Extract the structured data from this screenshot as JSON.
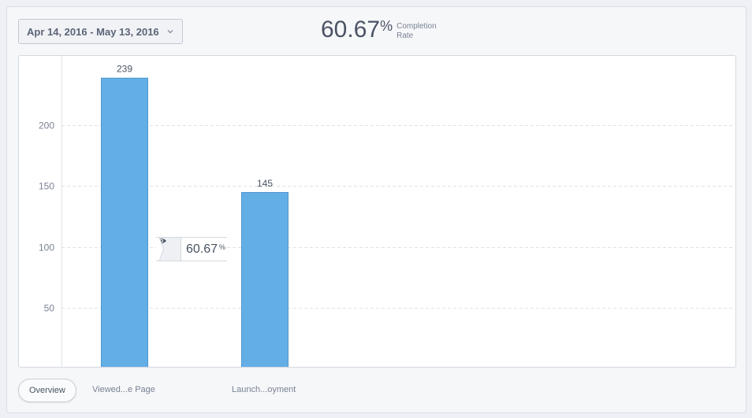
{
  "header": {
    "date_range": "Apr 14, 2016 - May 13, 2016",
    "completion_value": "60.67",
    "completion_suffix": "%",
    "completion_label_line1": "Completion",
    "completion_label_line2": "Rate"
  },
  "tooltip": {
    "value": "60.67",
    "suffix": "%",
    "icon": "eye-icon"
  },
  "tabs": {
    "overview": "Overview",
    "step1": "Viewed...e Page",
    "step2": "Launch...oyment"
  },
  "colors": {
    "bar": "#64aee6",
    "bar_border": "#4f97d0"
  },
  "chart_data": {
    "type": "bar",
    "categories": [
      "Viewed...e Page",
      "Launch...oyment"
    ],
    "values": [
      239,
      145
    ],
    "data_labels": [
      "239",
      "145"
    ],
    "yticks": [
      50,
      100,
      150,
      200
    ],
    "ylim": [
      0,
      250
    ],
    "grid": true,
    "title": "",
    "xlabel": "",
    "ylabel": ""
  }
}
